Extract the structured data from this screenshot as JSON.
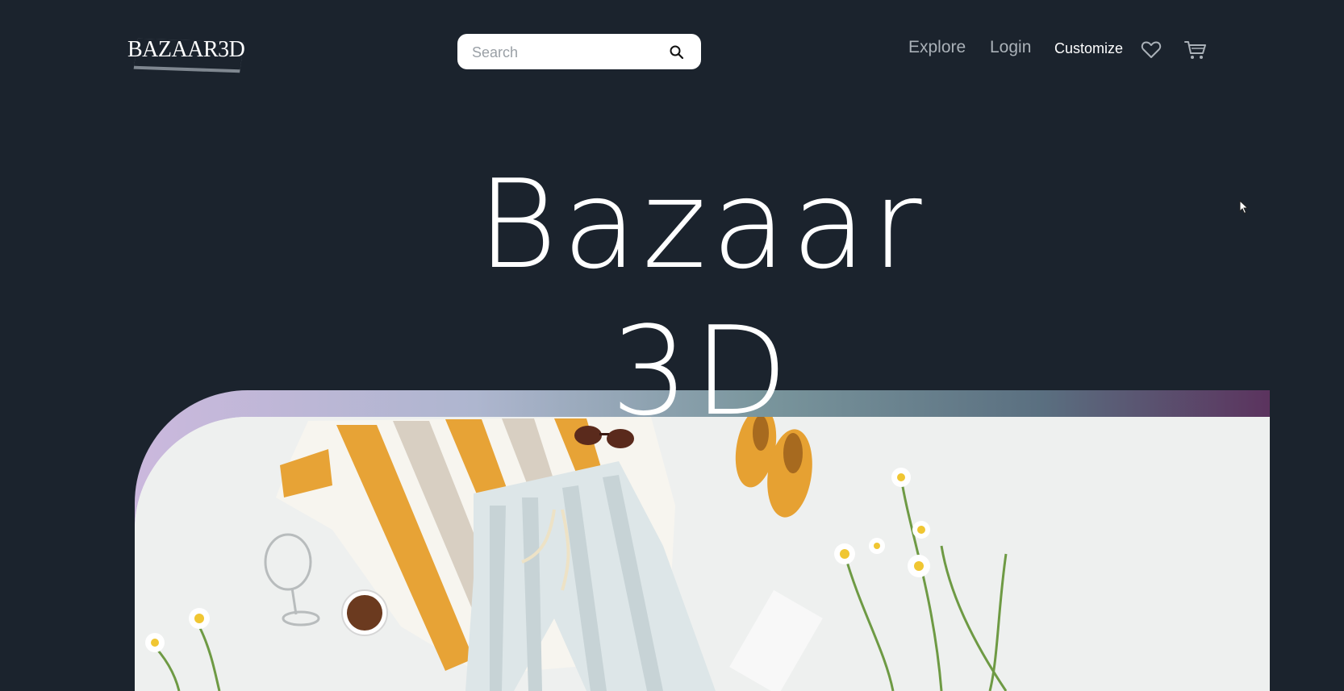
{
  "header": {
    "logo_text": "BAZAAR3D",
    "search": {
      "placeholder": "Search",
      "value": ""
    },
    "nav": [
      {
        "label": "Explore"
      },
      {
        "label": "Login"
      },
      {
        "label": "Customize"
      }
    ],
    "icons": [
      "heart-icon",
      "cart-icon",
      "search-icon"
    ]
  },
  "hero": {
    "title_line1": "Bazaar",
    "title_line2": "3D"
  },
  "colors": {
    "background": "#1b232d",
    "text": "#ffffff",
    "nav_muted": "#aab1b8",
    "gradient_start": "#cbb8dd",
    "gradient_end": "#5b335e"
  }
}
